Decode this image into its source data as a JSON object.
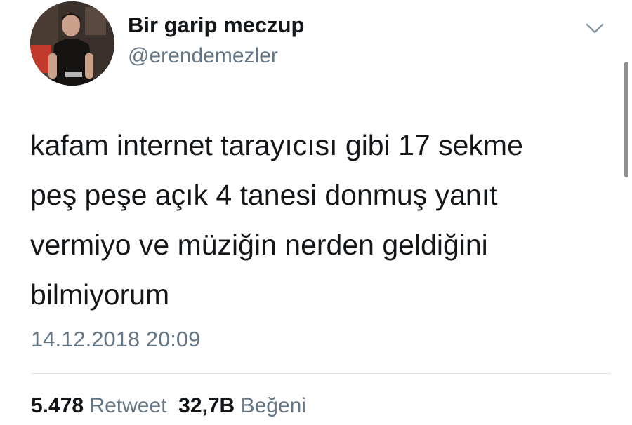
{
  "user": {
    "display_name": "Bir garip meczup",
    "handle": "@erendemezler",
    "avatar_icon": "profile-photo"
  },
  "menu": {
    "icon": "chevron-down-icon"
  },
  "tweet": {
    "text_lines": [
      "kafam internet tarayıcısı gibi 17 sekme",
      "peş peşe açık 4 tanesi donmuş yanıt",
      "vermiyo ve müziğin nerden geldiğini",
      "bilmiyorum"
    ],
    "timestamp": "14.12.2018 20:09"
  },
  "stats": {
    "retweet_count": "5.478",
    "retweet_label": "Retweet",
    "like_count": "32,7B",
    "like_label": "Beğeni"
  },
  "colors": {
    "text_primary": "#14171a",
    "text_secondary": "#657786",
    "divider": "#e1e8ed"
  }
}
